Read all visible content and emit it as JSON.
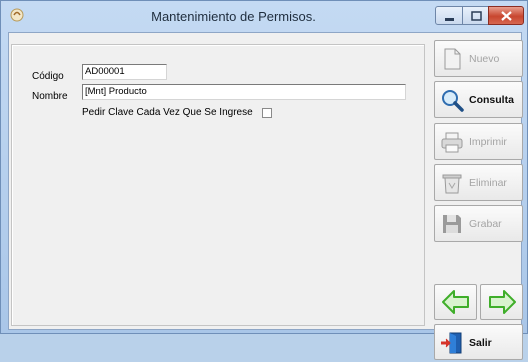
{
  "window": {
    "title": "Mantenimiento de Permisos."
  },
  "form": {
    "codigo_label": "Código",
    "codigo_value": "AD00001",
    "nombre_label": "Nombre",
    "nombre_value": "[Mnt] Producto",
    "pedir_clave_label": "Pedir Clave Cada Vez Que Se Ingrese",
    "pedir_clave_checked": false
  },
  "toolbar": {
    "nuevo": "Nuevo",
    "consulta": "Consulta",
    "imprimir": "Imprimir",
    "eliminar": "Eliminar",
    "grabar": "Grabar",
    "salir": "Salir"
  },
  "colors": {
    "nav_arrow": "#3fae2a",
    "close_button": "#c8462f",
    "title_bar": "#c4daf3"
  }
}
